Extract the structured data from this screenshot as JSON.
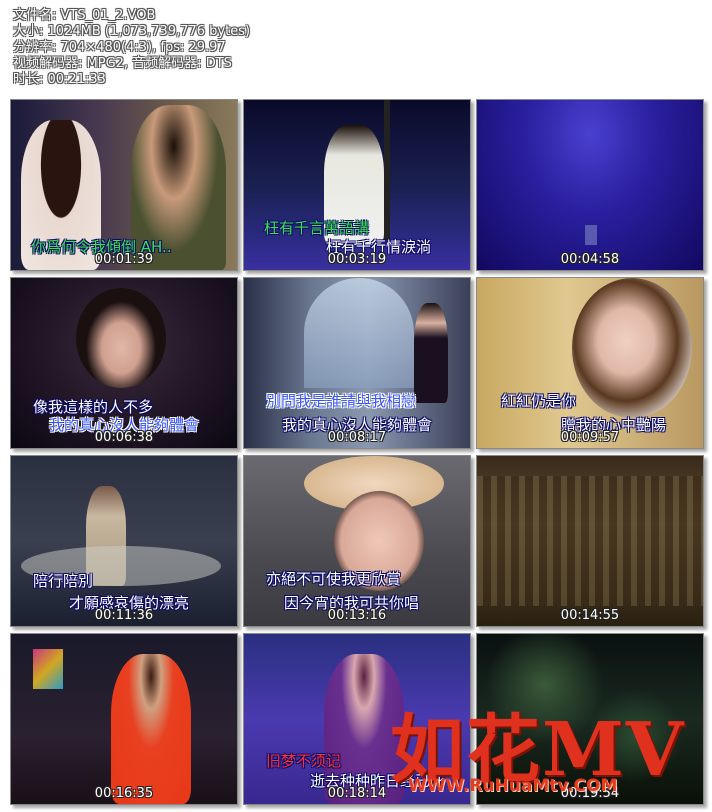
{
  "info": {
    "filename": "文件名: VTS_01_2.VOB",
    "size": "大小: 1024MB (1,073,739,776 bytes)",
    "resolution": "分辨率: 704×480(4:3), fps: 29.97",
    "codecs": "视频解码器: MPG2, 音频解码器: DTS",
    "duration": "时长: 00:21:33"
  },
  "thumbnails": [
    {
      "time": "00:01:39",
      "subs": [
        "你爲何令我傾倒 AH.."
      ]
    },
    {
      "time": "00:03:19",
      "subs": [
        "枉有千言萬語講",
        "枉有千行情淚淌"
      ]
    },
    {
      "time": "00:04:58",
      "subs": []
    },
    {
      "time": "00:06:38",
      "subs": [
        "像我這樣的人不多",
        "我的真心沒人能夠體會"
      ]
    },
    {
      "time": "00:08:17",
      "subs": [
        "別問我是誰請與我相戀",
        "我的真心沒人能夠體會"
      ]
    },
    {
      "time": "00:09:57",
      "subs": [
        "紅紅仍是你",
        "贈我的心中艷陽"
      ]
    },
    {
      "time": "00:11:36",
      "subs": [
        "陪行陪別",
        "才願感哀傷的漂亮"
      ]
    },
    {
      "time": "00:13:16",
      "subs": [
        "亦絕不可使我更欣賞",
        "因今宵的我可共你唱"
      ]
    },
    {
      "time": "00:14:55",
      "subs": []
    },
    {
      "time": "00:16:35",
      "subs": []
    },
    {
      "time": "00:18:14",
      "subs": [
        "旧梦不须记",
        "逝去种种昨日经已死"
      ]
    },
    {
      "time": "00:19:54",
      "subs": []
    }
  ],
  "logo": {
    "text": "如花MV",
    "url": "WWW.RuHuaMtv.COM"
  }
}
